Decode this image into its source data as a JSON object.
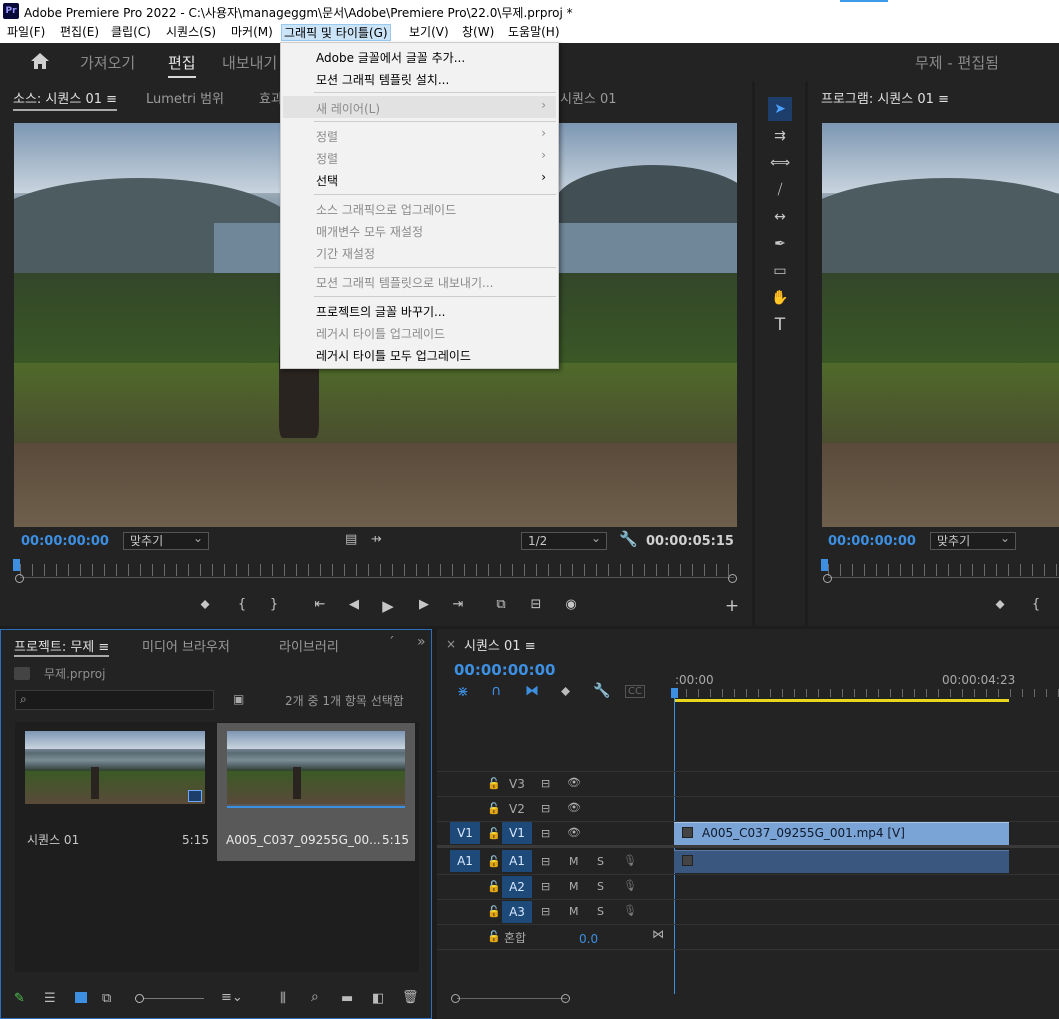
{
  "window": {
    "title": "Adobe Premiere Pro 2022 - C:\\사용자\\manageggm\\문서\\Adobe\\Premiere Pro\\22.0\\무제.prproj *",
    "app_icon": "Pr"
  },
  "menubar": {
    "items": [
      "파일(F)",
      "편집(E)",
      "클립(C)",
      "시퀀스(S)",
      "마커(M)",
      "그래픽 및 타이틀(G)",
      "보기(V)",
      "창(W)",
      "도움말(H)"
    ]
  },
  "workspace": {
    "tabs": [
      "가져오기",
      "편집",
      "내보내기"
    ],
    "project_title": "무제 - 편집됨"
  },
  "source_monitor": {
    "tabs": [
      "소스: 시퀀스 01",
      "Lumetri 범위",
      "효과"
    ],
    "timecode": "00:00:00:00",
    "fit": "맞추기",
    "resolution": "1/2",
    "duration": "00:00:05:15"
  },
  "program_monitor": {
    "hidden_tab": "시퀀스 01",
    "tab": "프로그램: 시퀀스 01",
    "timecode": "00:00:00:00",
    "fit": "맞추기"
  },
  "graphics_menu": {
    "items": [
      {
        "label": "Adobe 글꼴에서 글꼴 추가...",
        "disabled": false
      },
      {
        "label": "모션 그래픽 템플릿 설치...",
        "disabled": false
      },
      {
        "label": "새 레이어(L)",
        "disabled": true,
        "submenu": true
      },
      {
        "label": "정렬",
        "disabled": true,
        "submenu": true
      },
      {
        "label": "정렬",
        "disabled": true,
        "submenu": true
      },
      {
        "label": "선택",
        "disabled": false,
        "submenu": true
      },
      {
        "label": "소스 그래픽으로 업그레이드",
        "disabled": true
      },
      {
        "label": "매개변수 모두 재설정",
        "disabled": true
      },
      {
        "label": "기간 재설정",
        "disabled": true
      },
      {
        "label": "모션 그래픽 템플릿으로 내보내기...",
        "disabled": true
      },
      {
        "label": "프로젝트의 글꼴 바꾸기...",
        "disabled": false
      },
      {
        "label": "레거시 타이틀 업그레이드",
        "disabled": true
      },
      {
        "label": "레거시 타이틀 모두 업그레이드",
        "disabled": false
      }
    ]
  },
  "project_panel": {
    "tabs": [
      "프로젝트: 무제",
      "미디어 브라우저",
      "라이브러리"
    ],
    "file": "무제.prproj",
    "selection_info": "2개 중 1개 항목 선택함",
    "items": [
      {
        "name": "시퀀스 01",
        "duration": "5:15"
      },
      {
        "name": "A005_C037_09255G_00...",
        "duration": "5:15"
      }
    ]
  },
  "timeline": {
    "tab": "시퀀스 01",
    "timecode": "00:00:00:00",
    "ruler_start": ":00:00",
    "ruler_mark": "00:00:04:23",
    "video_tracks": [
      "V3",
      "V2",
      "V1"
    ],
    "audio_tracks": [
      "A1",
      "A2",
      "A3"
    ],
    "source_v": "V1",
    "source_a": "A1",
    "mix_label": "혼합",
    "mix_value": "0.0",
    "clip_name": "A005_C037_09255G_001.mp4 [V]",
    "m_label": "M",
    "s_label": "S"
  },
  "colors": {
    "accent": "#3d8fe2",
    "clip_video": "#7aa3d6",
    "clip_audio": "#3a5780",
    "playhead": "#3d8fe2",
    "work_area": "#e8d51e"
  }
}
